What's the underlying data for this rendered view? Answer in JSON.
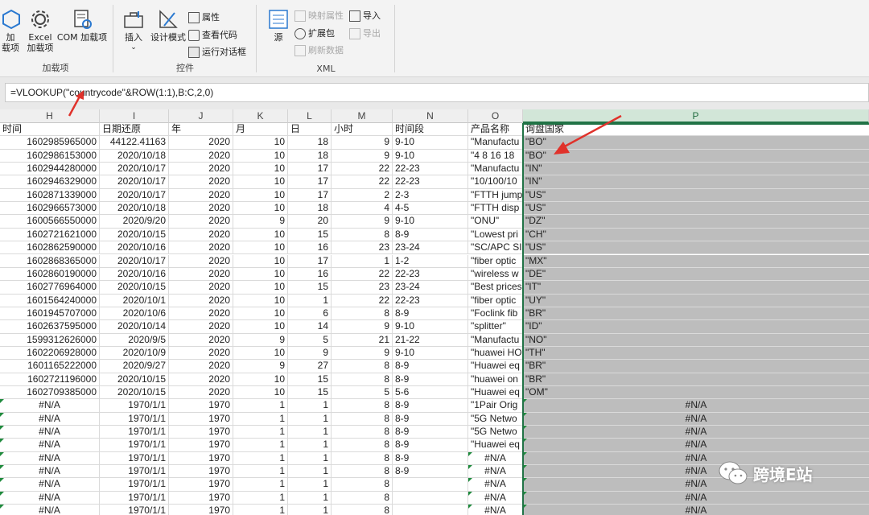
{
  "ribbon": {
    "addins_group": {
      "label": "加载项",
      "buttons": [
        "加\n载项",
        "Excel\n加载项",
        "COM 加载项"
      ]
    },
    "controls_group": {
      "label": "控件",
      "insert": "插入",
      "design_mode": "设计模式",
      "properties": "属性",
      "view_code": "查看代码",
      "run_dialog": "运行对话框"
    },
    "xml_group": {
      "label": "XML",
      "source": "源",
      "map_properties": "映射属性",
      "expansion_packs": "扩展包",
      "refresh_data": "刷新数据",
      "import": "导入",
      "export": "导出"
    }
  },
  "formula_bar": {
    "formula": "=VLOOKUP(\"countrycode\"&ROW(1:1),B:C,2,0)"
  },
  "columns": [
    "H",
    "I",
    "J",
    "K",
    "L",
    "M",
    "N",
    "O",
    "P"
  ],
  "header_row": [
    "时间",
    "日期还原",
    "年",
    "月",
    "日",
    "小时",
    "时间段",
    "产品名称",
    "询盘国家"
  ],
  "rows": [
    [
      "1602985965000",
      "44122.41163",
      "2020",
      "10",
      "18",
      "9",
      "9-10",
      "\"Manufactu",
      "\"BO\""
    ],
    [
      "1602986153000",
      "2020/10/18",
      "2020",
      "10",
      "18",
      "9",
      "9-10",
      "\"4 8 16 18",
      "\"BO\""
    ],
    [
      "1602944280000",
      "2020/10/17",
      "2020",
      "10",
      "17",
      "22",
      "22-23",
      "\"Manufactu",
      "\"IN\""
    ],
    [
      "1602946329000",
      "2020/10/17",
      "2020",
      "10",
      "17",
      "22",
      "22-23",
      "\"10/100/10",
      "\"IN\""
    ],
    [
      "1602871339000",
      "2020/10/17",
      "2020",
      "10",
      "17",
      "2",
      "2-3",
      "\"FTTH jump",
      "\"US\""
    ],
    [
      "1602966573000",
      "2020/10/18",
      "2020",
      "10",
      "18",
      "4",
      "4-5",
      "\"FTTH disp",
      "\"US\""
    ],
    [
      "1600566550000",
      "2020/9/20",
      "2020",
      "9",
      "20",
      "9",
      "9-10",
      "\"ONU\"",
      "\"DZ\""
    ],
    [
      "1602721621000",
      "2020/10/15",
      "2020",
      "10",
      "15",
      "8",
      "8-9",
      "\"Lowest pri",
      "\"CH\""
    ],
    [
      "1602862590000",
      "2020/10/16",
      "2020",
      "10",
      "16",
      "23",
      "23-24",
      "\"SC/APC SI",
      "\"US\""
    ],
    [
      "1602868365000",
      "2020/10/17",
      "2020",
      "10",
      "17",
      "1",
      "1-2",
      "\"fiber optic",
      "\"MX\""
    ],
    [
      "1602860190000",
      "2020/10/16",
      "2020",
      "10",
      "16",
      "22",
      "22-23",
      "\"wireless w",
      "\"DE\""
    ],
    [
      "1602776964000",
      "2020/10/15",
      "2020",
      "10",
      "15",
      "23",
      "23-24",
      "\"Best prices",
      "\"IT\""
    ],
    [
      "1601564240000",
      "2020/10/1",
      "2020",
      "10",
      "1",
      "22",
      "22-23",
      "\"fiber optic",
      "\"UY\""
    ],
    [
      "1601945707000",
      "2020/10/6",
      "2020",
      "10",
      "6",
      "8",
      "8-9",
      "\"Foclink fib",
      "\"BR\""
    ],
    [
      "1602637595000",
      "2020/10/14",
      "2020",
      "10",
      "14",
      "9",
      "9-10",
      "\"splitter\"",
      "\"ID\""
    ],
    [
      "1599312626000",
      "2020/9/5",
      "2020",
      "9",
      "5",
      "21",
      "21-22",
      "\"Manufactu",
      "\"NO\""
    ],
    [
      "1602206928000",
      "2020/10/9",
      "2020",
      "10",
      "9",
      "9",
      "9-10",
      "\"huawei HO",
      "\"TH\""
    ],
    [
      "1601165222000",
      "2020/9/27",
      "2020",
      "9",
      "27",
      "8",
      "8-9",
      "\"Huawei eq",
      "\"BR\""
    ],
    [
      "1602721196000",
      "2020/10/15",
      "2020",
      "10",
      "15",
      "8",
      "8-9",
      "\"huawei on",
      "\"BR\""
    ],
    [
      "1602709385000",
      "2020/10/15",
      "2020",
      "10",
      "15",
      "5",
      "5-6",
      "\"Huawei eq",
      "\"OM\""
    ],
    [
      "#N/A",
      "1970/1/1",
      "1970",
      "1",
      "1",
      "8",
      "8-9",
      "\"1Pair Orig",
      "#N/A"
    ],
    [
      "#N/A",
      "1970/1/1",
      "1970",
      "1",
      "1",
      "8",
      "8-9",
      "\"5G Netwo",
      "#N/A"
    ],
    [
      "#N/A",
      "1970/1/1",
      "1970",
      "1",
      "1",
      "8",
      "8-9",
      "\"5G Netwo",
      "#N/A"
    ],
    [
      "#N/A",
      "1970/1/1",
      "1970",
      "1",
      "1",
      "8",
      "8-9",
      "\"Huawei eq",
      "#N/A"
    ],
    [
      "#N/A",
      "1970/1/1",
      "1970",
      "1",
      "1",
      "8",
      "8-9",
      "#N/A",
      "#N/A"
    ],
    [
      "#N/A",
      "1970/1/1",
      "1970",
      "1",
      "1",
      "8",
      "8-9",
      "#N/A",
      "#N/A"
    ],
    [
      "#N/A",
      "1970/1/1",
      "1970",
      "1",
      "1",
      "8",
      "",
      "#N/A",
      "#N/A"
    ],
    [
      "#N/A",
      "1970/1/1",
      "1970",
      "1",
      "1",
      "8",
      "",
      "#N/A",
      "#N/A"
    ],
    [
      "#N/A",
      "1970/1/1",
      "1970",
      "1",
      "1",
      "8",
      "",
      "#N/A",
      "#N/A"
    ]
  ],
  "watermark": {
    "text": "跨境E站",
    "icon": "wechat-icon"
  },
  "colors": {
    "selection": "#217346",
    "selected_fill": "#bdbdbd",
    "arrow": "#e0322b"
  }
}
